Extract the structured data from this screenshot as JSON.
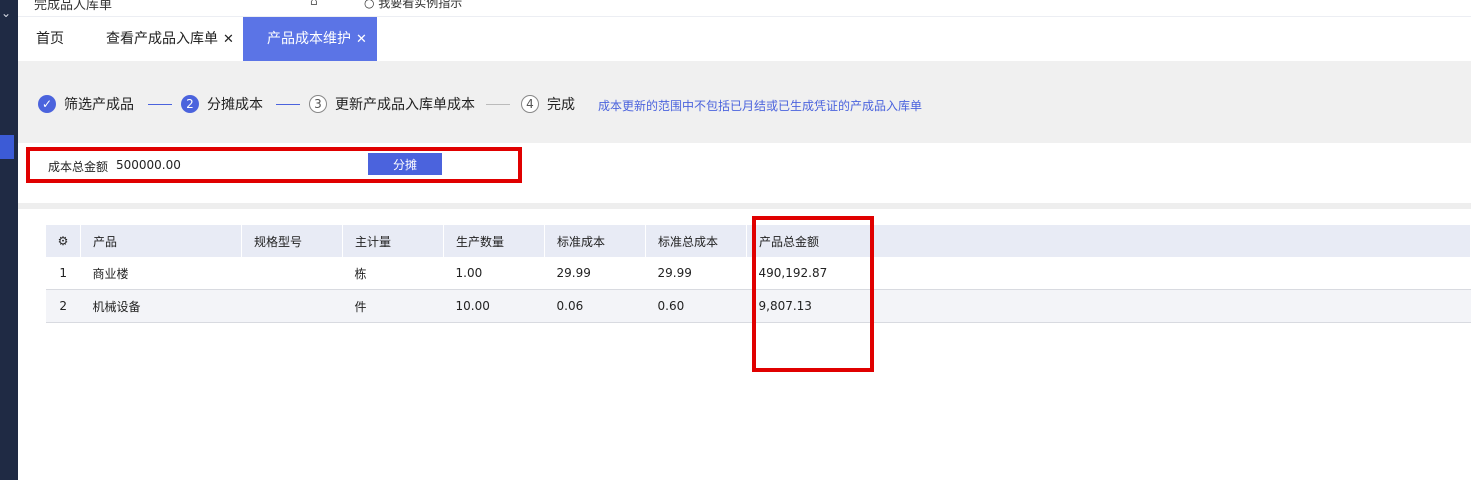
{
  "top": {
    "crumb": "完成品人库单",
    "tool": "⌂",
    "tool2": "○ 我要看实例指示"
  },
  "tabs": [
    {
      "label": "首页"
    },
    {
      "label": "查看产成品入库单"
    },
    {
      "label": "产品成本维护"
    }
  ],
  "steps": [
    {
      "num": "1",
      "label": "筛选产成品"
    },
    {
      "num": "2",
      "label": "分摊成本"
    },
    {
      "num": "3",
      "label": "更新产成品入库单成本"
    },
    {
      "num": "4",
      "label": "完成"
    }
  ],
  "hint": "成本更新的范围中不包括已月结或已生成凭证的产成品入库单",
  "form": {
    "cost_label": "成本总金额",
    "cost_value": "500000.00",
    "button": "分摊"
  },
  "table": {
    "headers": [
      "产品",
      "规格型号",
      "主计量",
      "生产数量",
      "标准成本",
      "标准总成本",
      "产品总金额"
    ],
    "rows": [
      {
        "index": "1",
        "product": "商业楼",
        "spec": "",
        "unit": "栋",
        "qty": "1.00",
        "std_cost": "29.99",
        "std_total": "29.99",
        "total": "490,192.87"
      },
      {
        "index": "2",
        "product": "机械设备",
        "spec": "",
        "unit": "件",
        "qty": "10.00",
        "std_cost": "0.06",
        "std_total": "0.60",
        "total": "9,807.13"
      }
    ]
  },
  "colors": {
    "accent": "#4b63dd",
    "tab_active": "#5b74e6",
    "highlight": "#e00000",
    "sidebar": "#1f2a44"
  },
  "icons": {
    "settings": "gear-icon",
    "close": "close-icon",
    "check": "check-icon"
  }
}
